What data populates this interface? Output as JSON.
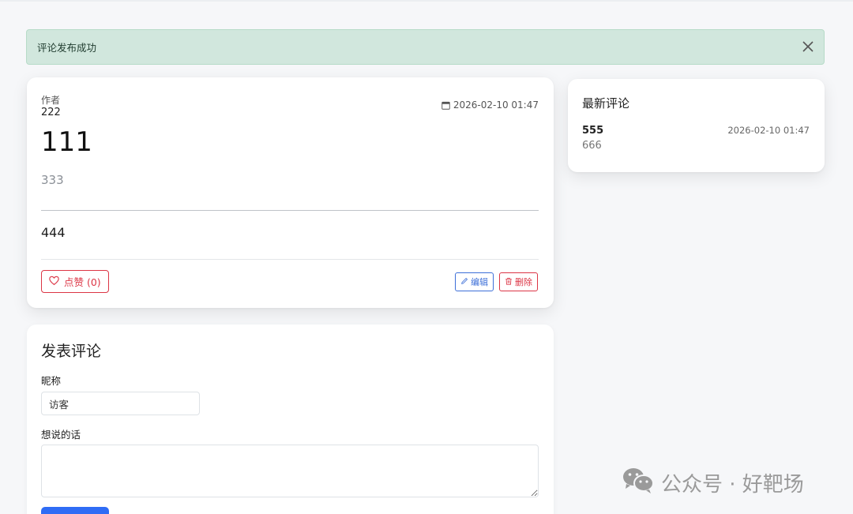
{
  "alert": {
    "message": "评论发布成功",
    "close_icon": "close-icon"
  },
  "post": {
    "author_label": "作者",
    "author_value": "222",
    "date": "2026-02-10 01:47",
    "title": "111",
    "subtitle": "333",
    "body": "444",
    "like_label": "点赞 (0)",
    "edit_label": "编辑",
    "delete_label": "删除",
    "colors": {
      "danger": "#dc3545",
      "primary": "#3d6fd8"
    }
  },
  "latest": {
    "title": "最新评论",
    "items": [
      {
        "author": "555",
        "date": "2026-02-10 01:47",
        "content": "666"
      }
    ]
  },
  "comment_form": {
    "title": "发表评论",
    "nickname_label": "昵称",
    "nickname_value": "访客",
    "message_label": "想说的话",
    "message_value": "",
    "submit_color": "#2f6cf5"
  },
  "watermark": {
    "text": "公众号 · 好靶场"
  }
}
